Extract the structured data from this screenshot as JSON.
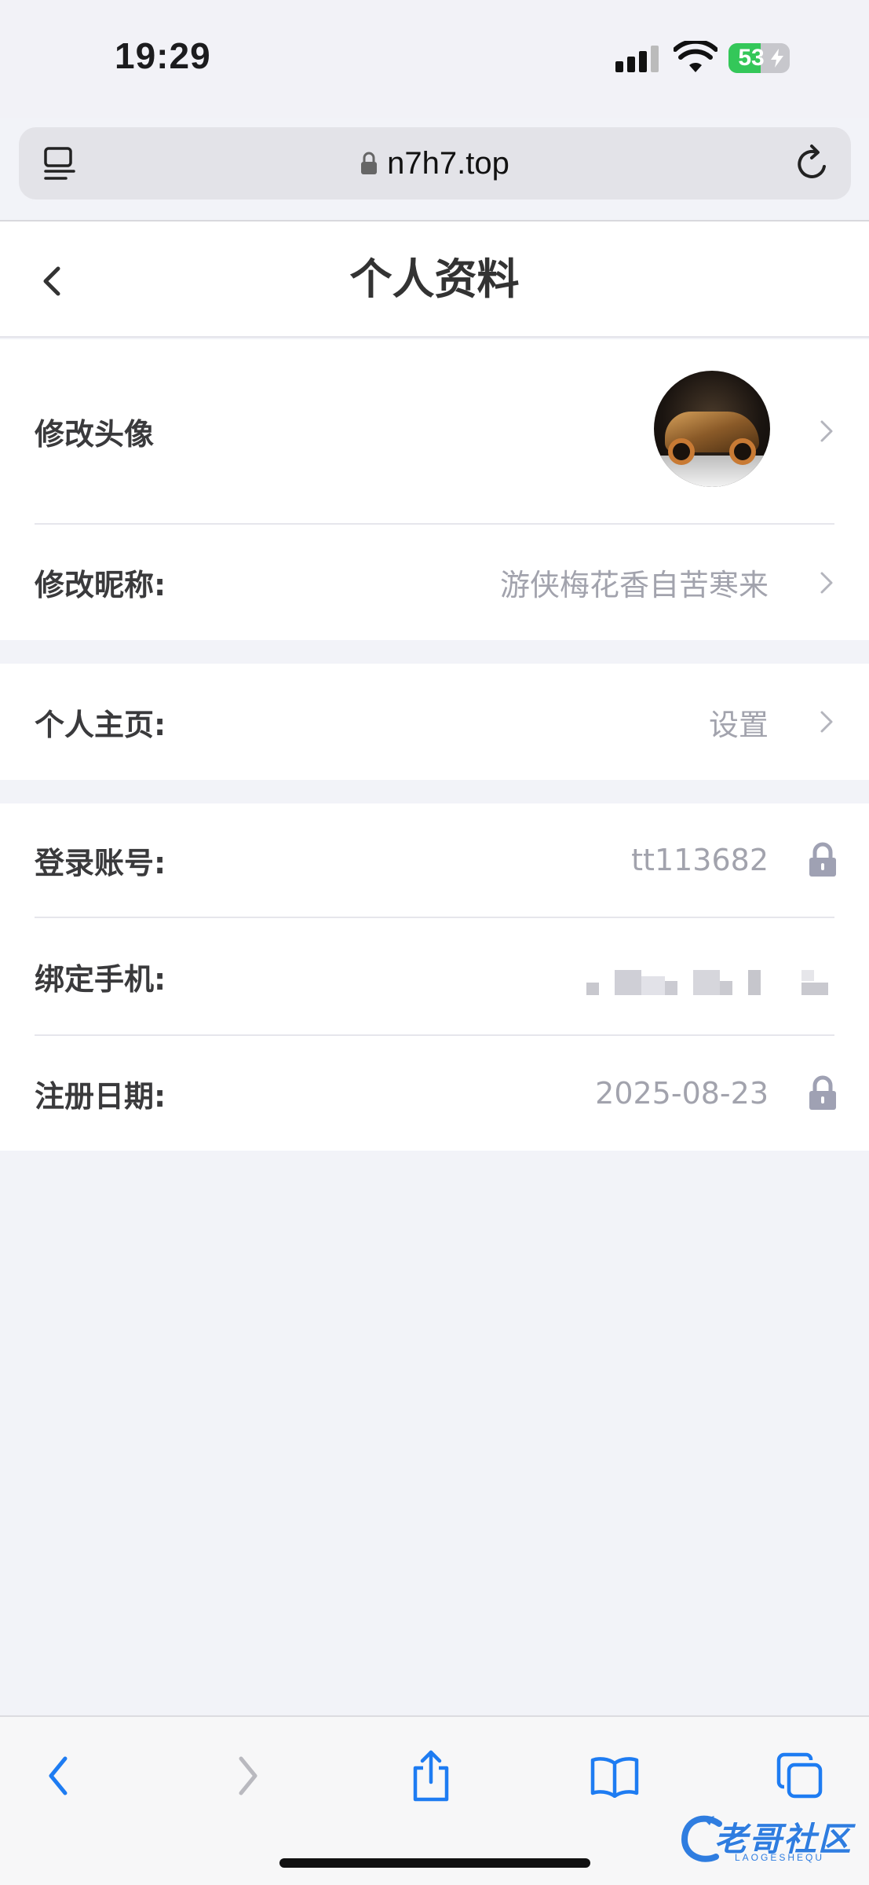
{
  "status_bar": {
    "time": "19:29",
    "battery_percent": "53",
    "battery_level": 0.53
  },
  "browser": {
    "url": "n7h7.top",
    "toolbar_icons": [
      "back-icon",
      "forward-icon",
      "share-icon",
      "bookmarks-icon",
      "tabs-icon"
    ]
  },
  "header": {
    "title": "个人资料"
  },
  "profile": {
    "avatar_label": "修改头像",
    "nickname_label": "修改昵称:",
    "nickname_value": "游侠梅花香自苦寒来",
    "homepage_label": "个人主页:",
    "homepage_value": "设置",
    "account_label": "登录账号:",
    "account_value": "tt113682",
    "phone_label": "绑定手机:",
    "register_label": "注册日期:",
    "register_value": "2025-08-23"
  },
  "watermark": {
    "text": "老哥社区",
    "sub": "LAOGESHEQU"
  },
  "colors": {
    "page_bg": "#f2f3f8",
    "value_gray": "#a2a3ad",
    "lock_gray": "#9fa1b3",
    "accent_blue": "#007aff",
    "battery_green": "#34c759"
  }
}
